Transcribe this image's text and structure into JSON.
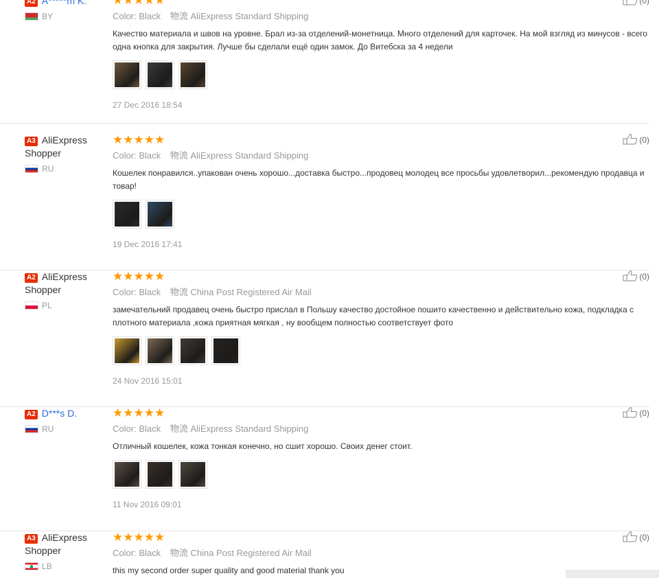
{
  "reviews": [
    {
      "level": "A2",
      "user": "A*****m K.",
      "user_link": true,
      "country": "BY",
      "flag": "by",
      "color_key": "Color:",
      "color_val": "Black",
      "ship_key": "物流",
      "ship_val": "AliExpress Standard Shipping",
      "text": "Качество материала и швов на уровне. Брал из-за отделений-монетница. Много отделений для карточек. На мой взгляд из минусов - всего одна кнопка для закрытия. Лучше бы сделали ещё один замок. До Витебска за 4 недели",
      "photos": [
        "#6e5a3e",
        "#3d3b3a",
        "#5b4530"
      ],
      "date": "27 Dec 2016 18:54",
      "helpful": "(0)"
    },
    {
      "level": "A3",
      "user": "AliExpress Shopper",
      "user_link": false,
      "country": "RU",
      "flag": "ru",
      "color_key": "Color:",
      "color_val": "Black",
      "ship_key": "物流",
      "ship_val": "AliExpress Standard Shipping",
      "text": "Кошелек понравился..упакован очень хорошо...доставка быстро...продовец молодец все просьбы удовлетворил...рекомендую продавца и товар!",
      "photos": [
        "#2b2a28",
        "#2d4a64"
      ],
      "date": "19 Dec 2016 17:41",
      "helpful": "(0)"
    },
    {
      "level": "A2",
      "user": "AliExpress Shopper",
      "user_link": false,
      "country": "PL",
      "flag": "pl",
      "color_key": "Color:",
      "color_val": "Black",
      "ship_key": "物流",
      "ship_val": "China Post Registered Air Mail",
      "text": "замечательний продавец очень быстро прислал в Польшу качество достойное пошито качественно и действительно кожа, подкладка с плотного материала ,кожа приятная мягкая , ну вообщем полностью соответствует фото",
      "photos": [
        "#c99a2e",
        "#7d6a55",
        "#3e3a36",
        "#24211f"
      ],
      "date": "24 Nov 2016 15:01",
      "helpful": "(0)"
    },
    {
      "level": "A2",
      "user": "D***s D.",
      "user_link": true,
      "country": "RU",
      "flag": "ru",
      "color_key": "Color:",
      "color_val": "Black",
      "ship_key": "物流",
      "ship_val": "AliExpress Standard Shipping",
      "text": "Отличный кошелек, кожа тонкая конечно, но сшит хорошо. Своих денег стоит.",
      "photos": [
        "#5a4e48",
        "#3b2f29",
        "#4e4840"
      ],
      "date": "11 Nov 2016 09:01",
      "helpful": "(0)"
    },
    {
      "level": "A3",
      "user": "AliExpress Shopper",
      "user_link": false,
      "country": "LB",
      "flag": "lb",
      "color_key": "Color:",
      "color_val": "Black",
      "ship_key": "物流",
      "ship_val": "China Post Registered Air Mail",
      "text": "this my second order super quality and good material thank you",
      "photos": [],
      "date": "",
      "helpful": "(0)"
    }
  ],
  "colors": {
    "star": "#ff9a00",
    "level_badge": "#e62e04",
    "link": "#2c6bd8",
    "muted": "#999999"
  },
  "icons": {
    "helpful": "thumbs-up-icon",
    "star": "star-icon"
  }
}
